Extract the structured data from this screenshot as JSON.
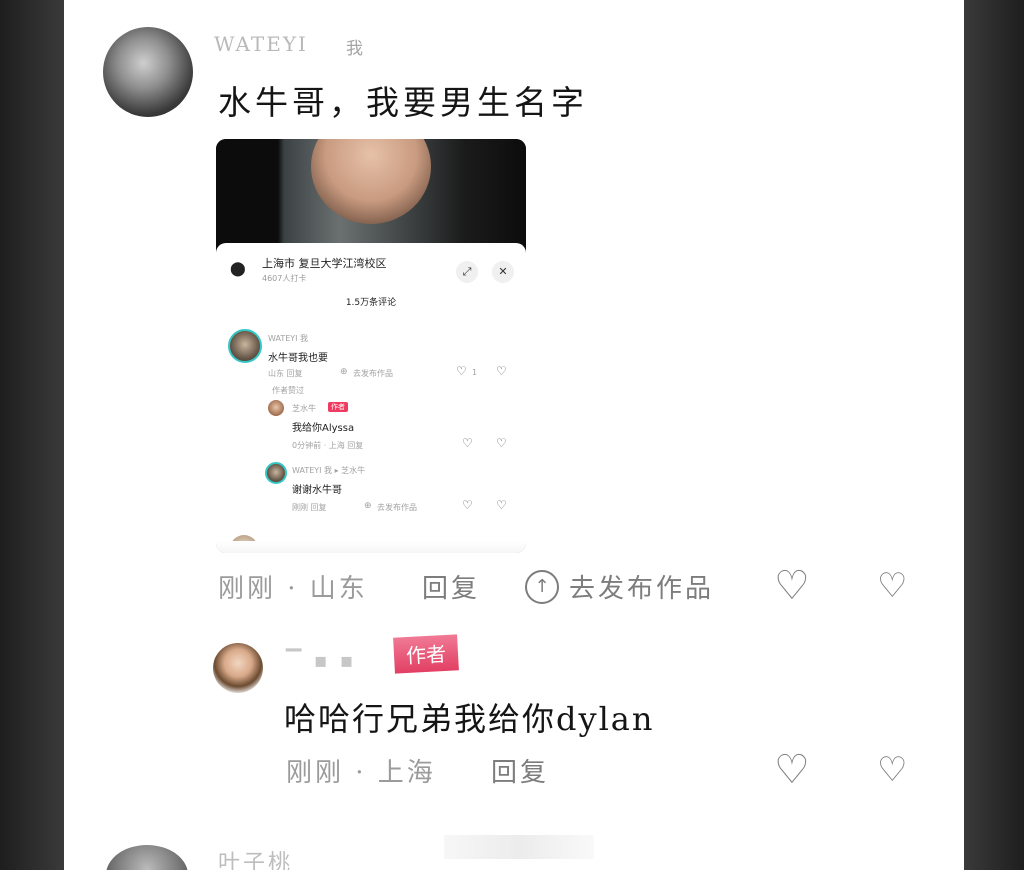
{
  "comment1": {
    "username": "WATEYI",
    "me_tag": "我",
    "text": "水牛哥，我要男生名字",
    "meta": "刚刚 · 山东",
    "reply_label": "回复",
    "publish_label": "去发布作品"
  },
  "embedded": {
    "location": "上海市  复旦大学江湾校区",
    "checkins": "4607人打卡",
    "comment_count": "1.5万条评论",
    "c1_user": "WATEYI  我",
    "c1_text": "水牛哥我也要",
    "c1_meta": "山东    回复",
    "c1_publish": "去发布作品",
    "c1_likes": "1",
    "author_liked": "作者赞过",
    "c2_user": "芝水牛",
    "c2_badge": "作者",
    "c2_text": "我给你Alyssa",
    "c2_meta": "0分钟前 · 上海     回复",
    "c3_user": "WATEYI  我 ▸ 芝水牛",
    "c3_text": "谢谢水牛哥",
    "c3_meta": "刚刚     回复",
    "c3_publish": "去发布作品"
  },
  "reply": {
    "badge": "作者",
    "text": "哈哈行兄弟我给你dylan",
    "meta": "刚刚 · 上海",
    "reply_label": "回复"
  },
  "comment3": {
    "username": "叶子桃"
  },
  "icons": {
    "like": "heart-icon",
    "dislike": "broken-heart-icon",
    "publish": "arrow-up-circle-icon",
    "location": "location-pin-icon"
  }
}
